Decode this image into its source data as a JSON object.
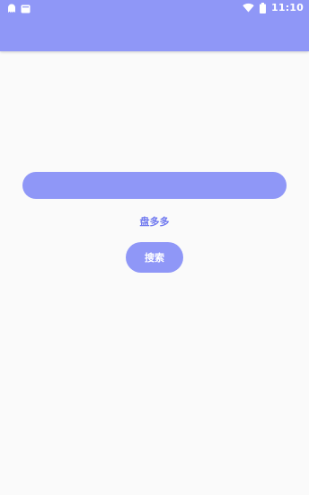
{
  "status_bar": {
    "time": "11:10",
    "icons": [
      "notification-ghost-icon",
      "notification-card-icon",
      "wifi-icon",
      "battery-icon"
    ]
  },
  "app_bar": {
    "background": "#8f97f7"
  },
  "search": {
    "value": "",
    "placeholder": ""
  },
  "brand_label": "盘多多",
  "search_button_label": "搜索",
  "colors": {
    "accent": "#8f97f7",
    "brand_text": "#6f78ef",
    "background": "#fafafa"
  }
}
